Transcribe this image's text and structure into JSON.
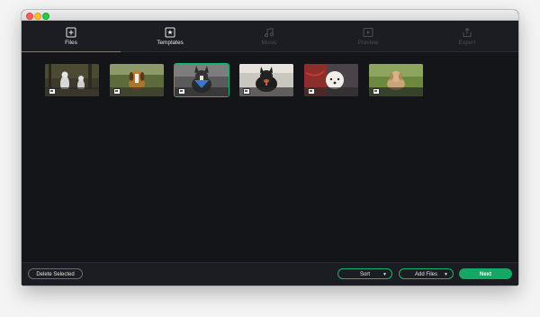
{
  "steps": [
    {
      "label": "Files",
      "icon": "add-file-icon",
      "state": "active"
    },
    {
      "label": "Templates",
      "icon": "star-frame-icon",
      "state": "enabled"
    },
    {
      "label": "Music",
      "icon": "music-note-icon",
      "state": "disabled"
    },
    {
      "label": "Preview",
      "icon": "play-frame-icon",
      "state": "disabled"
    },
    {
      "label": "Export",
      "icon": "share-icon",
      "state": "disabled"
    }
  ],
  "files": [
    {
      "thumb": "two-dogs-in-woods",
      "icon": "image-icon",
      "selected": false
    },
    {
      "thumb": "beagle-in-field",
      "icon": "image-icon",
      "selected": false
    },
    {
      "thumb": "dog-with-bandana",
      "icon": "image-icon",
      "selected": true
    },
    {
      "thumb": "black-dog-running",
      "icon": "image-icon",
      "selected": false
    },
    {
      "thumb": "white-fluffy-dog",
      "icon": "image-icon",
      "selected": false
    },
    {
      "thumb": "puppy-on-grass",
      "icon": "image-icon",
      "selected": false
    }
  ],
  "footer": {
    "delete_label": "Delete Selected",
    "sort_label": "Sort",
    "add_files_label": "Add Files",
    "next_label": "Next"
  },
  "colors": {
    "accent": "#19b36b",
    "background": "#141519",
    "panel": "#1c1d22"
  }
}
